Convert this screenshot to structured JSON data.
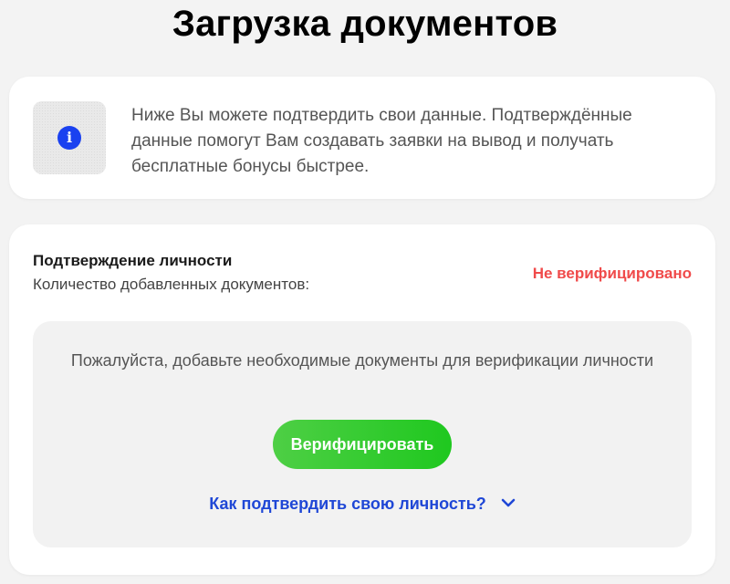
{
  "header": {
    "title": "Загрузка документов"
  },
  "info": {
    "icon": "info-icon",
    "icon_glyph": "i",
    "text": "Ниже Вы можете подтвердить свои данные. Подтверждённые данные помогут Вам создавать заявки на вывод и получать бесплатные бонусы быстрее."
  },
  "identity": {
    "title": "Подтверждение личности",
    "docs_count_label": "Количество добавленных документов:",
    "status": "Не верифицировано",
    "status_color": "#f04a4a",
    "upload_prompt": "Пожалуйста, добавьте необходимые документы для верификации личности",
    "verify_button_label": "Верифицировать",
    "help_link_label": "Как подтвердить свою личность?",
    "help_link_icon": "chevron-down-icon"
  },
  "colors": {
    "accent_blue": "#1f47d6",
    "button_green": "#2ecb2a",
    "info_icon_blue": "#1a41f0"
  }
}
